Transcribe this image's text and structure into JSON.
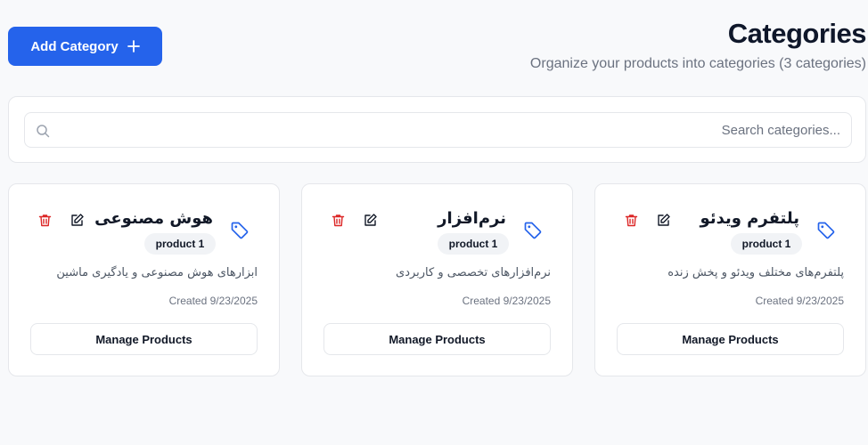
{
  "header": {
    "title": "Categories",
    "subtitle": "Organize your products into categories (3 categories)",
    "add_button_label": "Add Category"
  },
  "search": {
    "placeholder": "Search categories..."
  },
  "categories": [
    {
      "name": "هوش مصنوعی",
      "product_count": "product 1",
      "description": "ابزارهای هوش مصنوعی و یادگیری ماشین",
      "created": "Created 9/23/2025",
      "manage_label": "Manage Products"
    },
    {
      "name": "نرم‌افزار",
      "product_count": "product 1",
      "description": "نرم‌افزارهای تخصصی و کاربردی",
      "created": "Created 9/23/2025",
      "manage_label": "Manage Products"
    },
    {
      "name": "پلتفرم ویدئو",
      "product_count": "product 1",
      "description": "پلتفرم‌های مختلف ویدئو و پخش زنده",
      "created": "Created 9/23/2025",
      "manage_label": "Manage Products"
    }
  ],
  "icons": {
    "add": "plus-icon",
    "search": "search-icon",
    "category": "tag-icon",
    "edit": "edit-icon",
    "delete": "trash-icon"
  },
  "colors": {
    "primary": "#2563eb",
    "danger": "#dc2626",
    "tag": "#2563eb",
    "background": "#f8f9fb"
  }
}
